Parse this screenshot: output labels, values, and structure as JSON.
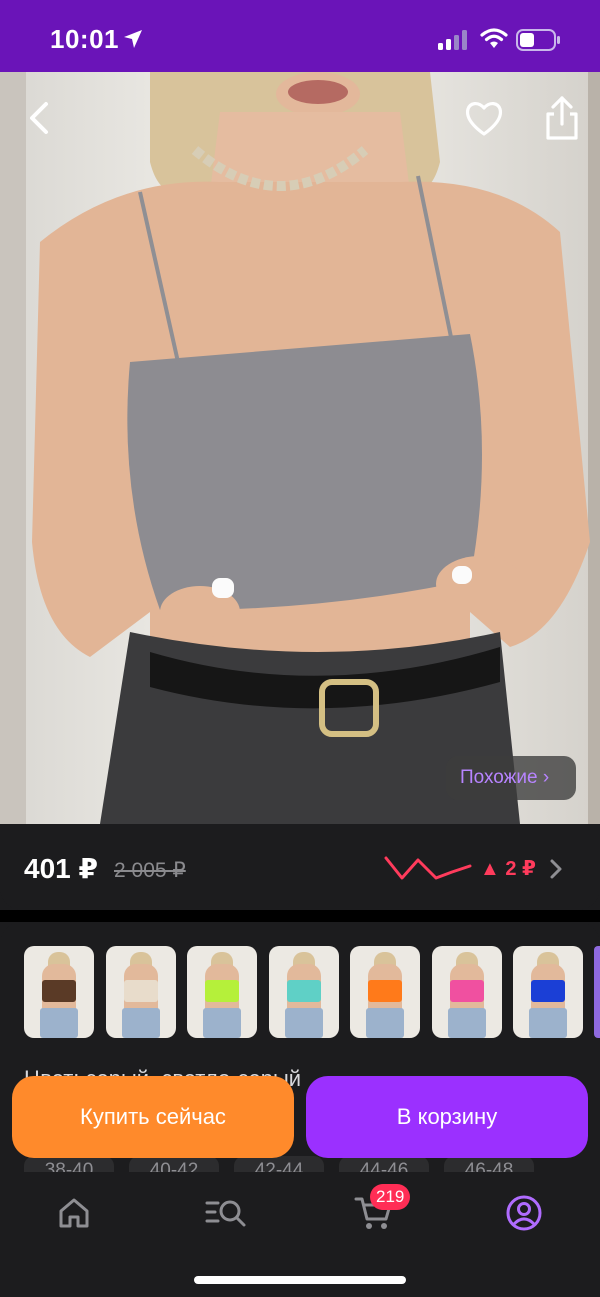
{
  "status_bar": {
    "time": "10:01"
  },
  "product": {
    "similar_label": "Похожие ›",
    "price_current": "401 ₽",
    "price_old": "2 005 ₽",
    "price_delta": "▲ 2 ₽"
  },
  "variants": {
    "colors": [
      {
        "name": "brown",
        "color": "#5a3a26"
      },
      {
        "name": "beige",
        "color": "#e8dccb"
      },
      {
        "name": "lime",
        "color": "#b5f03a"
      },
      {
        "name": "mint",
        "color": "#5fd0c6"
      },
      {
        "name": "orange",
        "color": "#ff7a1a"
      },
      {
        "name": "pink",
        "color": "#f050a0"
      },
      {
        "name": "blue",
        "color": "#1b3fd6"
      }
    ],
    "color_label": "Цвет: серый, светло-серый",
    "sizes": [
      "38-40",
      "40-42",
      "42-44",
      "44-46",
      "46-48"
    ]
  },
  "actions": {
    "buy_now": "Купить сейчас",
    "add_to_cart": "В корзину"
  },
  "tabbar": {
    "items": [
      "home-icon",
      "catalog-search-icon",
      "cart-icon",
      "profile-icon"
    ],
    "cart_count": "219",
    "active_color": "#b06cff"
  }
}
